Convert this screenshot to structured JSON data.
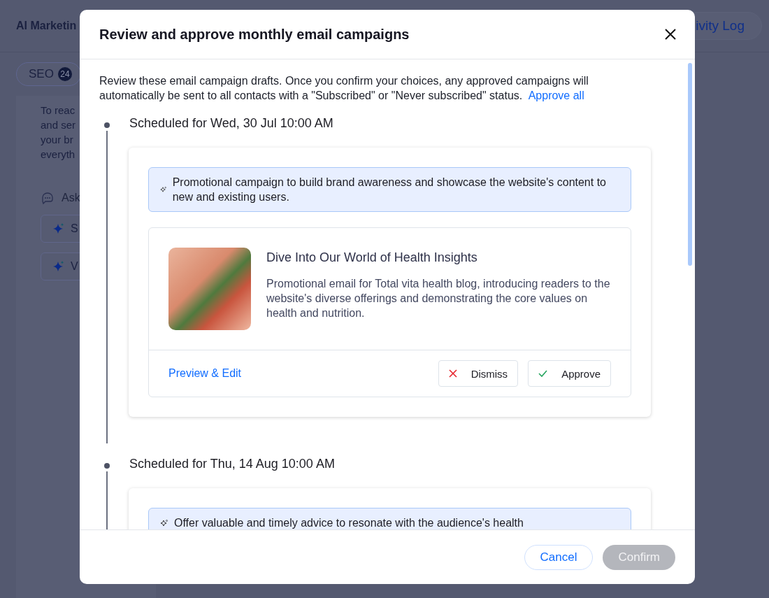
{
  "background": {
    "app_title": "AI Marketin",
    "right_button": "ivity Log",
    "seo_tab": {
      "label": "SEO",
      "count": "24"
    },
    "intro_lines": [
      "To reac",
      "and ser",
      "your br",
      "everyth"
    ],
    "ask_label": "Ask",
    "suggestions": [
      "S",
      "V"
    ]
  },
  "dialog": {
    "title": "Review and approve monthly email campaigns",
    "intro": "Review these email campaign drafts. Once you confirm your choices, any approved campaigns will automatically be sent to all contacts with a \"Subscribed\" or \"Never subscribed\" status.",
    "approve_all": "Approve all",
    "campaigns": [
      {
        "schedule": "Scheduled for Wed, 30 Jul 10:00 AM",
        "summary": "Promotional campaign to build brand awareness and showcase the website's content to new and existing users.",
        "email": {
          "title": "Dive Into Our World of Health Insights",
          "description": "Promotional email for Total vita health blog, introducing readers to the website's diverse offerings and demonstrating the core values on health and nutrition.",
          "preview_link": "Preview & Edit",
          "dismiss": "Dismiss",
          "approve": "Approve"
        }
      },
      {
        "schedule": "Scheduled for Thu, 14 Aug 10:00 AM",
        "summary": "Offer valuable and timely advice to resonate with the audience's health"
      }
    ],
    "footer": {
      "cancel": "Cancel",
      "confirm": {
        "label": "Confirm",
        "disabled": true
      }
    }
  }
}
